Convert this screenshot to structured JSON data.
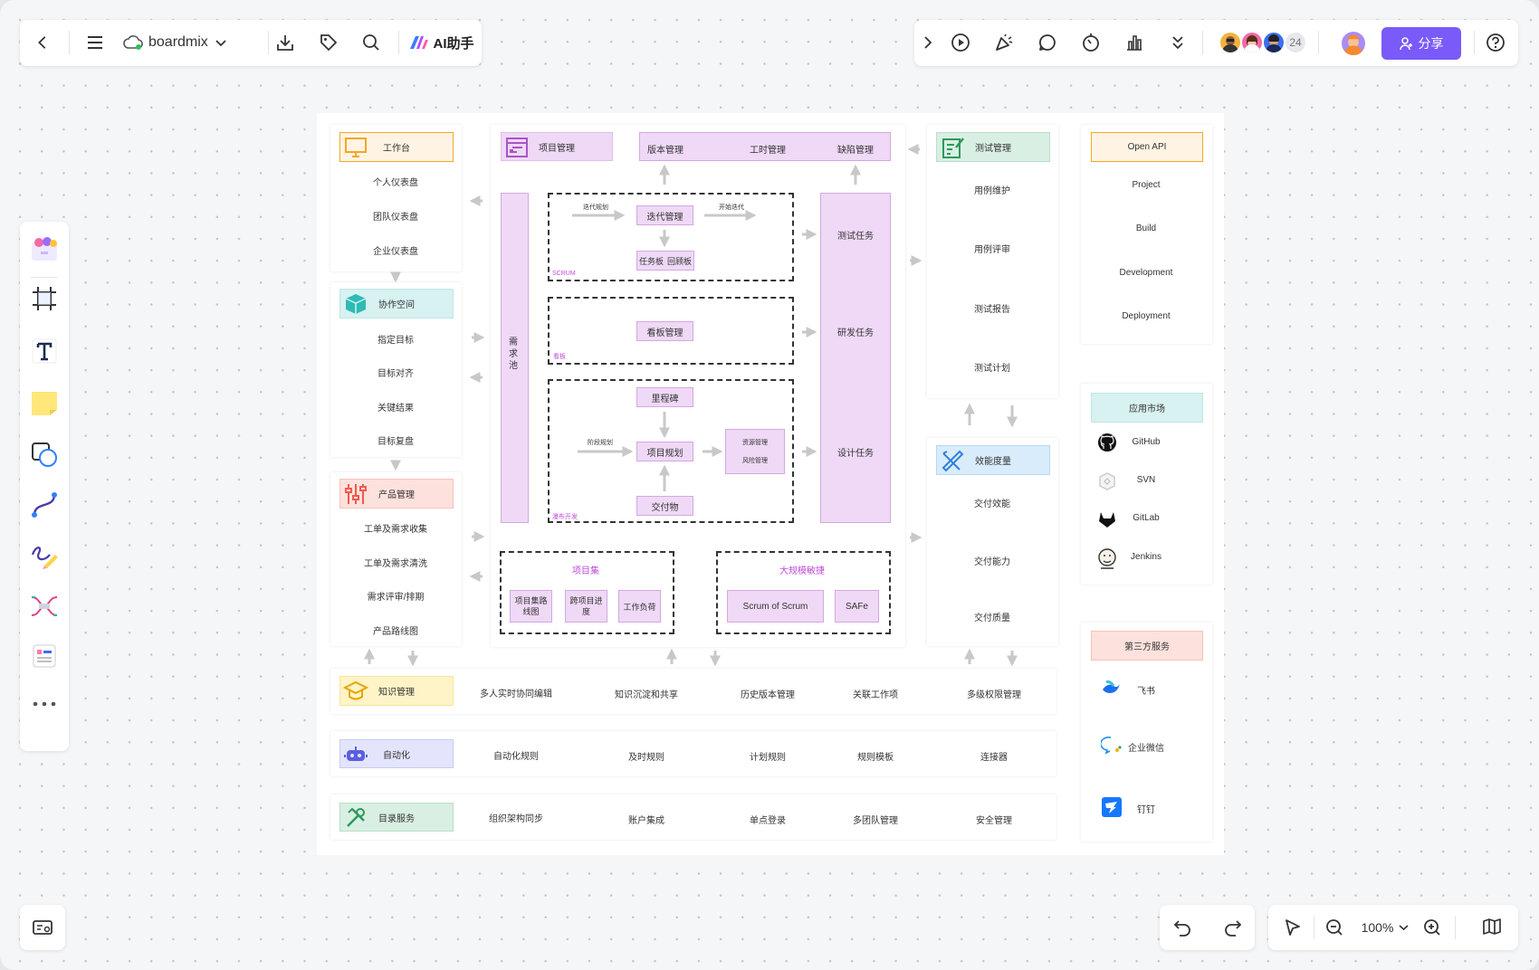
{
  "topbar": {
    "app_name": "boardmix",
    "ai_label": "AI助手",
    "participant_count": "24",
    "share_label": "分享"
  },
  "zoom": {
    "level": "100%"
  },
  "board": {
    "col1": {
      "workspace": {
        "title": "工作台",
        "items": [
          "个人仪表盘",
          "团队仪表盘",
          "企业仪表盘"
        ]
      },
      "collab": {
        "title": "协作空间",
        "items": [
          "指定目标",
          "目标对齐",
          "关键结果",
          "目标复盘"
        ]
      },
      "product": {
        "title": "产品管理",
        "items": [
          "工单及需求收集",
          "工单及需求清洗",
          "需求评审/排期",
          "产品路线图"
        ]
      }
    },
    "center": {
      "project_mgmt": "项目管理",
      "version_mgmt": "版本管理",
      "time_mgmt": "工时管理",
      "defect_mgmt": "缺陷管理",
      "req_pool": "需求池",
      "iter_plan_label": "迭代规划",
      "start_iter_label": "开始迭代",
      "iter_mgmt": "迭代管理",
      "task_board": "任务板",
      "burndown": "回顾板",
      "scrum_label": "SCRUM",
      "kanban_mgmt": "看板管理",
      "kanban_label": "看板",
      "milestone": "里程碑",
      "phase_plan_label": "阶段规划",
      "project_plan": "项目规划",
      "resource_mgmt": "资源管理",
      "risk_mgmt": "风险管理",
      "deliverable": "交付物",
      "waterfall_label": "瀑布开发",
      "test_task": "测试任务",
      "dev_task": "研发任务",
      "design_task": "设计任务",
      "project_set": {
        "title": "项目集",
        "items": [
          "项目集路线图",
          "跨项目进度",
          "工作负荷"
        ]
      },
      "scale_agile": {
        "title": "大规模敏捷",
        "items": [
          "Scrum of Scrum",
          "SAFe"
        ]
      }
    },
    "col3": {
      "test_mgmt": {
        "title": "测试管理",
        "items": [
          "用例维护",
          "用例评审",
          "测试报告",
          "测试计划"
        ]
      },
      "efficiency": {
        "title": "效能度量",
        "items": [
          "交付效能",
          "交付能力",
          "交付质量"
        ]
      }
    },
    "col4": {
      "open_api": {
        "title": "Open API",
        "items": [
          "Project",
          "Build",
          "Development",
          "Deployment"
        ]
      },
      "app_market": {
        "title": "应用市场",
        "items": [
          "GitHub",
          "SVN",
          "GitLab",
          "Jenkins"
        ]
      },
      "third_party": {
        "title": "第三方服务",
        "items": [
          "飞书",
          "企业微信",
          "钉钉"
        ]
      }
    },
    "rows": {
      "knowledge": {
        "title": "知识管理",
        "items": [
          "多人实时协同编辑",
          "知识沉淀和共享",
          "历史版本管理",
          "关联工作项",
          "多级权限管理"
        ]
      },
      "automation": {
        "title": "自动化",
        "items": [
          "自动化规则",
          "及时规则",
          "计划规则",
          "规则模板",
          "连接器"
        ]
      },
      "directory": {
        "title": "目录服务",
        "items": [
          "组织架构同步",
          "账户集成",
          "单点登录",
          "多团队管理",
          "安全管理"
        ]
      }
    },
    "colors": {
      "accent": "#7a5af8",
      "orange": "#f5a623",
      "purple_fill": "#efd9f6",
      "teal_fill": "#d8f1f1",
      "blue_fill": "#d9ecfb",
      "pink_fill": "#fde1dc",
      "yellow_fill": "#fff4c7",
      "green_fill": "#d9efe3",
      "lavender_fill": "#e4e5fc"
    }
  }
}
